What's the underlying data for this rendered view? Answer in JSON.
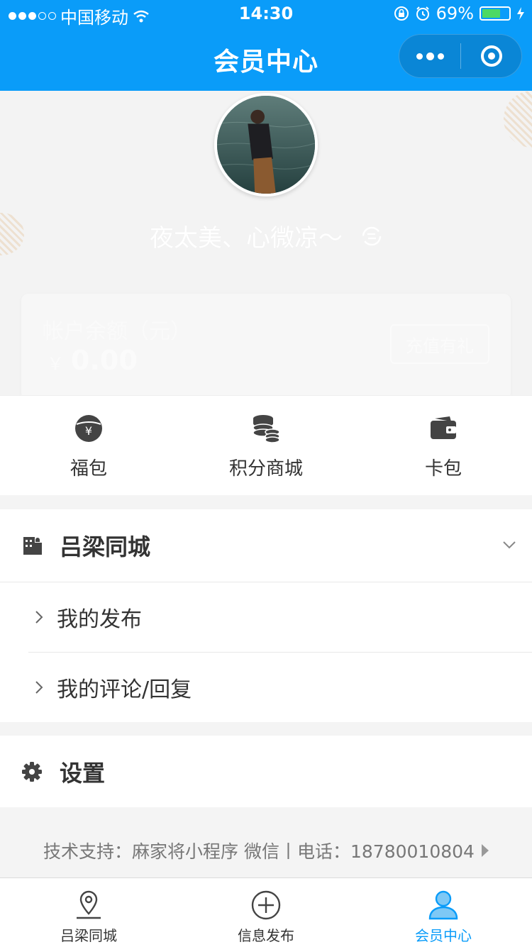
{
  "status_bar": {
    "carrier": "中国移动",
    "time": "14:30",
    "battery": "69%",
    "battery_level": 0.69
  },
  "nav": {
    "title": "会员中心"
  },
  "profile": {
    "nickname": "夜太美、心微凉～",
    "balance_label": "帐户余额（元）",
    "currency": "￥",
    "balance": "0.00",
    "recharge_label": "充值有礼"
  },
  "shortcuts": [
    {
      "label": "福包",
      "icon": "yen-coin-icon"
    },
    {
      "label": "积分商城",
      "icon": "coins-stack-icon"
    },
    {
      "label": "卡包",
      "icon": "wallet-icon"
    }
  ],
  "section": {
    "title": "吕梁同城",
    "items": [
      {
        "label": "我的发布"
      },
      {
        "label": "我的评论/回复"
      }
    ]
  },
  "settings": {
    "label": "设置"
  },
  "support": {
    "text": "技术支持：麻家将小程序 微信丨电话：18780010804"
  },
  "tabbar": [
    {
      "label": "吕梁同城",
      "icon": "location-pin-icon",
      "active": false
    },
    {
      "label": "信息发布",
      "icon": "plus-circle-icon",
      "active": false
    },
    {
      "label": "会员中心",
      "icon": "user-icon",
      "active": true
    }
  ],
  "colors": {
    "primary": "#0a9cf9",
    "battery": "#4cd964"
  }
}
